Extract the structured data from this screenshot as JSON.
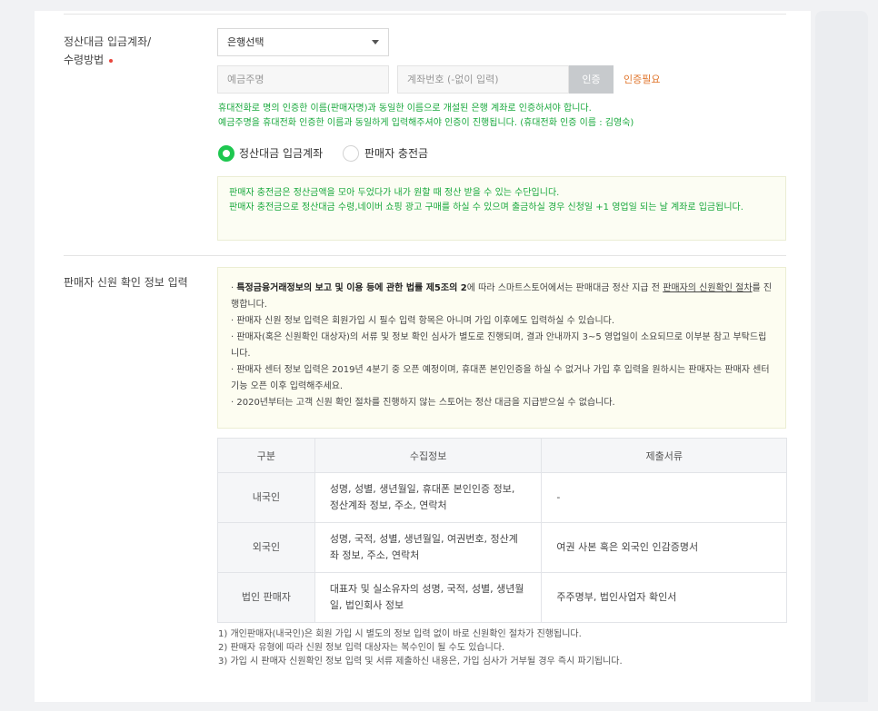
{
  "settlement": {
    "label_line1": "정산대금 입금계좌/",
    "label_line2": "수령방법",
    "bank_select": "은행선택",
    "holder_placeholder": "예금주명",
    "account_placeholder": "계좌번호 (-없이 입력)",
    "auth_button": "인증",
    "auth_required": "인증필요",
    "note_line1": "휴대전화로 명의 인증한 이름(판매자명)과 동일한 이름으로 개설된 은행 계좌로 인증하셔야 합니다.",
    "note_line2": "예금주명을 휴대전화 인증한 이름과 동일하게 입력해주셔야 인증이 진행됩니다. (휴대전화 인증 이름 : 김영숙)",
    "radio_account": "정산대금 입금계좌",
    "radio_charge": "판매자 충전금",
    "charge_info_line1": "판매자 충전금은 정산금액을 모아 두었다가 내가 원할 때 정산 받을 수 있는 수단입니다.",
    "charge_info_line2": "판매자 충전금으로 정산대금 수령,네이버 쇼핑 광고 구매를 하실 수 있으며 출금하실 경우 신청일 +1 영업일 되는 날 계좌로 입금됩니다."
  },
  "credit": {
    "label": "판매자 신원 확인 정보 입력",
    "notice": {
      "b1_prefix": "· ",
      "b1_bold": "특정금융거래정보의 보고 및 이용 등에 관한 법률 제5조의 2",
      "b1_mid": "에 따라 스마트스토어에서는 판매대금 정산 지급 전 ",
      "b1_link": "판매자의 신원확인 절차",
      "b1_suffix": "를 진행합니다.",
      "b2": "· 판매자 신원 정보 입력은 회원가입 시 필수 입력 항목은 아니며 가입 이후에도 입력하실 수 있습니다.",
      "b3": "· 판매자(혹은 신원확인 대상자)의 서류 및 정보 확인 심사가 별도로 진행되며, 결과 안내까지 3~5 영업일이 소요되므로 이부분 참고 부탁드립니다.",
      "b4": "· 판매자 센터 정보 입력은 2019년 4분기 중 오픈 예정이며, 휴대폰 본인인증을 하실 수 없거나 가입 후 입력을 원하시는 판매자는 판매자 센터 기능 오픈 이후 입력해주세요.",
      "b5": "· 2020년부터는 고객 신원 확인 절차를 진행하지 않는 스토어는 정산 대금을 지급받으실 수 없습니다."
    },
    "table": {
      "headers": [
        "구분",
        "수집정보",
        "제출서류"
      ],
      "rows": [
        {
          "type": "내국인",
          "info": "성명, 성별, 생년월일, 휴대폰 본인인증 정보, 정산계좌 정보, 주소, 연락처",
          "docs": "-"
        },
        {
          "type": "외국인",
          "info": "성명, 국적, 성별, 생년월일, 여권번호, 정산계좌 정보, 주소, 연락처",
          "docs": "여권 사본 혹은 외국인 인감증명서"
        },
        {
          "type": "법인 판매자",
          "info": "대표자 및 실소유자의 성명, 국적, 성별, 생년월일, 법인회사 정보",
          "docs": "주주명부, 법인사업자 확인서"
        }
      ]
    },
    "footnotes": [
      "1) 개인판매자(내국인)은 회원 가입 시 별도의 정보 입력 없이 바로 신원확인 절차가 진행됩니다.",
      "2) 판매자 유형에 따라 신원 정보 입력 대상자는 복수인이 될 수도 있습니다.",
      "3) 가입 시 판매자 신원확인 정보 입력 및 서류 제출하신 내용은, 가입 심사가 거부될 경우 즉시 파기됩니다."
    ]
  }
}
